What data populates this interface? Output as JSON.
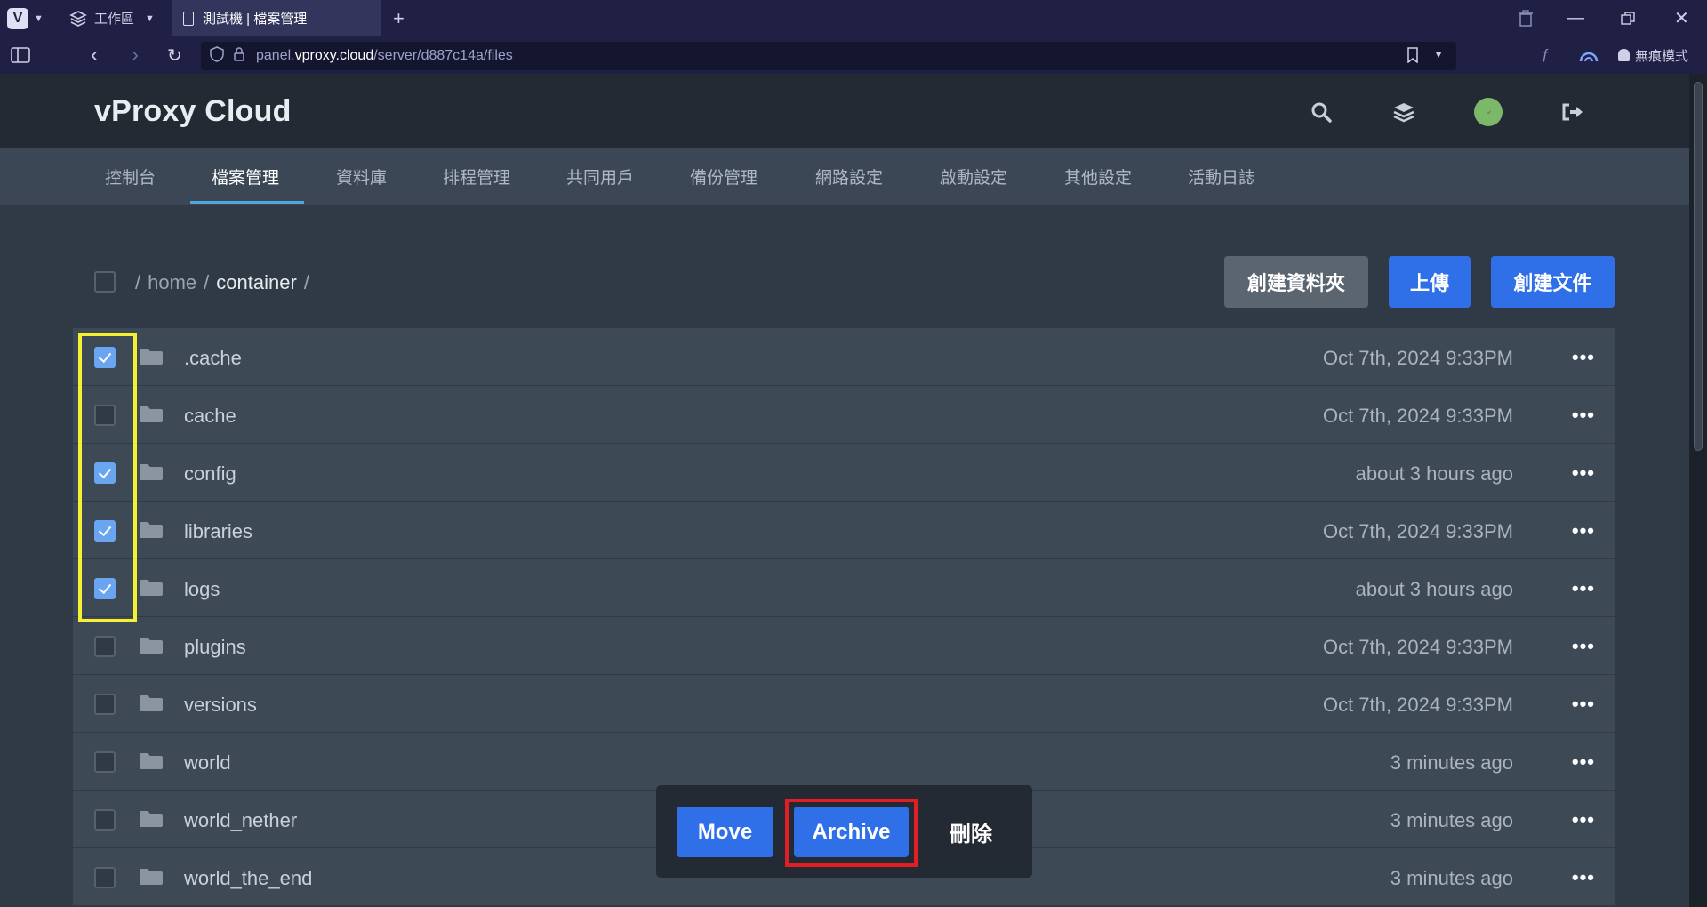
{
  "browser": {
    "workspace_label": "工作區",
    "tab_title": "測試機 | 檔案管理",
    "url_prefix": "panel.",
    "url_host": "vproxy.cloud",
    "url_path": "/server/d887c14a/files",
    "incognito_label": "無痕模式"
  },
  "site": {
    "logo": "vProxy Cloud"
  },
  "nav": {
    "items": [
      "控制台",
      "檔案管理",
      "資料庫",
      "排程管理",
      "共同用戶",
      "備份管理",
      "網路設定",
      "啟動設定",
      "其他設定",
      "活動日誌"
    ],
    "active_index": 1
  },
  "toolbar": {
    "breadcrumb_sep": "/",
    "breadcrumb_home": "home",
    "breadcrumb_current": "container",
    "create_folder_label": "創建資料夾",
    "upload_label": "上傳",
    "create_file_label": "創建文件"
  },
  "files": [
    {
      "name": ".cache",
      "date": "Oct 7th, 2024 9:33PM",
      "checked": true
    },
    {
      "name": "cache",
      "date": "Oct 7th, 2024 9:33PM",
      "checked": false
    },
    {
      "name": "config",
      "date": "about 3 hours ago",
      "checked": true
    },
    {
      "name": "libraries",
      "date": "Oct 7th, 2024 9:33PM",
      "checked": true
    },
    {
      "name": "logs",
      "date": "about 3 hours ago",
      "checked": true
    },
    {
      "name": "plugins",
      "date": "Oct 7th, 2024 9:33PM",
      "checked": false
    },
    {
      "name": "versions",
      "date": "Oct 7th, 2024 9:33PM",
      "checked": false
    },
    {
      "name": "world",
      "date": "3 minutes ago",
      "checked": false
    },
    {
      "name": "world_nether",
      "date": "3 minutes ago",
      "checked": false
    },
    {
      "name": "world_the_end",
      "date": "3 minutes ago",
      "checked": false
    }
  ],
  "more_label": "•••",
  "actions": {
    "move_label": "Move",
    "archive_label": "Archive",
    "delete_label": "刪除"
  },
  "colors": {
    "accent_blue": "#2f6fe8",
    "checkbox_checked": "#6aa5f2",
    "highlight_yellow": "#f5f031",
    "highlight_red": "#e01e24"
  }
}
